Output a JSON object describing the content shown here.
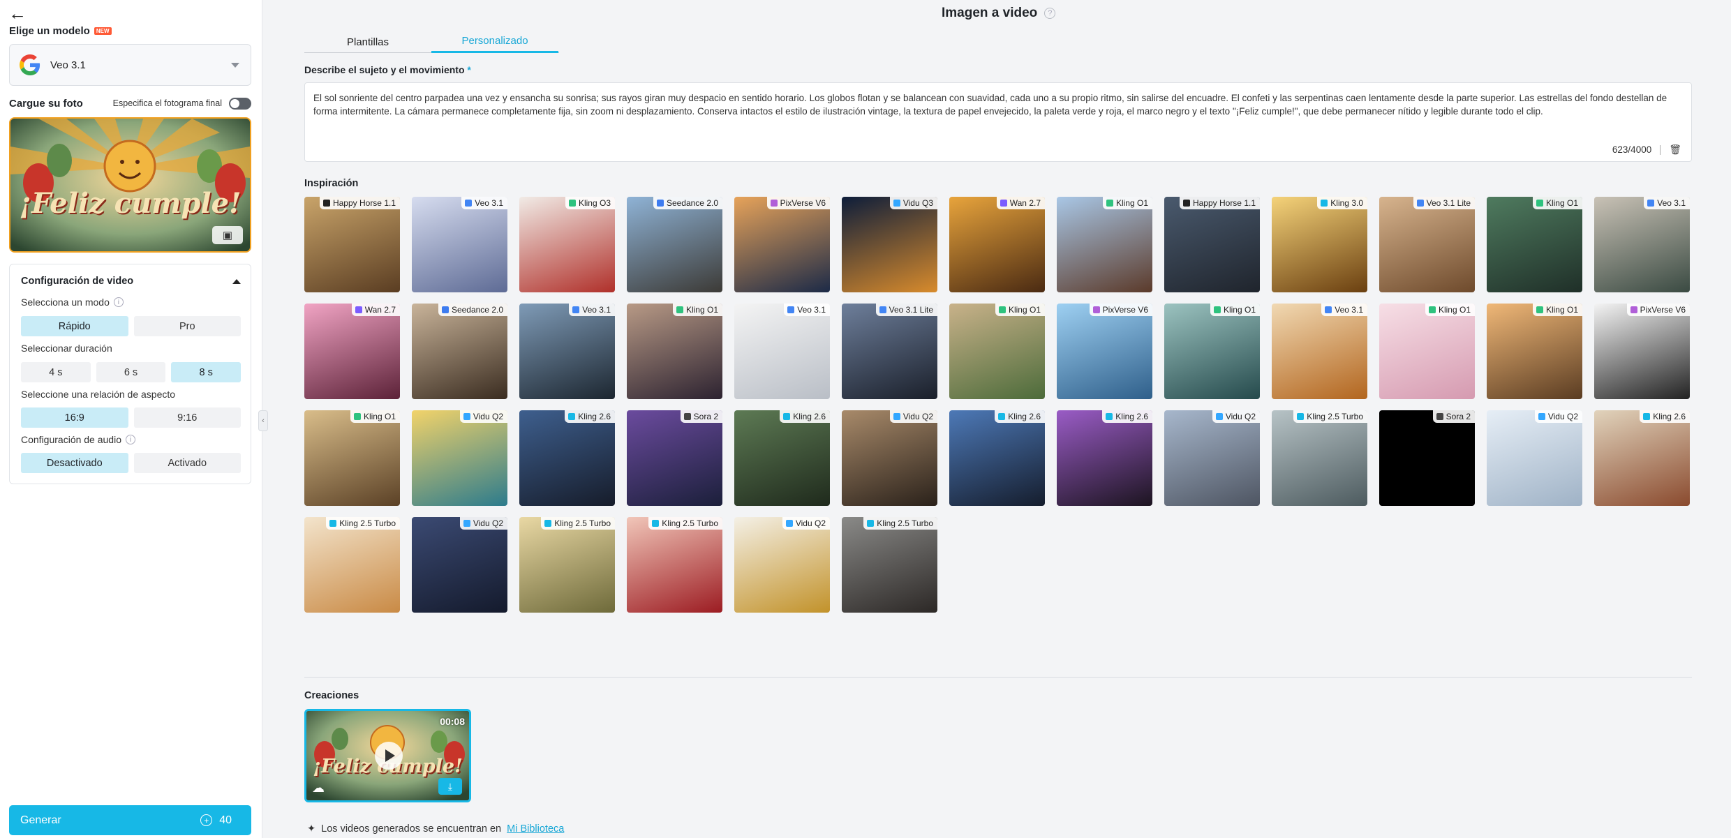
{
  "sidebar": {
    "back_icon": "arrow-left-icon",
    "model_heading": "Elige un modelo",
    "new_badge": "NEW",
    "model_selected": "Veo 3.1",
    "photo_label": "Cargue su foto",
    "end_frame_label": "Especifica el fotograma final",
    "end_frame_enabled": false,
    "upload_image_text": "¡Feliz cumple!",
    "config": {
      "title": "Configuración de video",
      "mode_label": "Selecciona un modo",
      "modes": [
        "Rápido",
        "Pro"
      ],
      "mode_selected": "Rápido",
      "duration_label": "Seleccionar duración",
      "durations": [
        "4 s",
        "6 s",
        "8 s"
      ],
      "duration_selected": "8 s",
      "aspect_label": "Seleccione una relación de aspecto",
      "aspects": [
        "16:9",
        "9:16"
      ],
      "aspect_selected": "16:9",
      "audio_label": "Configuración de audio",
      "audio_options": [
        "Desactivado",
        "Activado"
      ],
      "audio_selected": "Desactivado"
    },
    "generate_label": "Generar",
    "credits": "40"
  },
  "main": {
    "title": "Imagen a video",
    "tabs": [
      {
        "label": "Plantillas",
        "active": false
      },
      {
        "label": "Personalizado",
        "active": true
      }
    ],
    "description_label": "Describe el sujeto y el movimiento",
    "required_mark": "*",
    "prompt": "El sol sonriente del centro parpadea una vez y ensancha su sonrisa; sus rayos giran muy despacio en sentido horario. Los globos flotan y se balancean con suavidad, cada uno a su propio ritmo, sin salirse del encuadre. El confeti y las serpentinas caen lentamente desde la parte superior. Las estrellas del fondo destellan de forma intermitente. La cámara permanece completamente fija, sin zoom ni desplazamiento. Conserva intactos el estilo de ilustración vintage, la textura de papel envejecido, la paleta verde y roja, el marco negro y el texto \"¡Feliz cumple!\", que debe permanecer nítido y legible durante todo el clip.",
    "char_count": "623/4000",
    "inspiration_label": "Inspiración",
    "inspiration": [
      {
        "model": "Happy Horse 1.1",
        "c1": "#c9a46a",
        "c2": "#5a3d22",
        "dot": "#222222"
      },
      {
        "model": "Veo 3.1",
        "c1": "#d6dcef",
        "c2": "#5e6b95",
        "dot": "#4285f4"
      },
      {
        "model": "Kling O3",
        "c1": "#f1ebe6",
        "c2": "#b0302a",
        "dot": "#2ec27e"
      },
      {
        "model": "Seedance 2.0",
        "c1": "#8fb3d6",
        "c2": "#3c3a36",
        "dot": "#3d7cf0"
      },
      {
        "model": "PixVerse V6",
        "c1": "#e7a35a",
        "c2": "#1c2a47",
        "dot": "#b05fd8"
      },
      {
        "model": "Vidu Q3",
        "c1": "#0d1d3a",
        "c2": "#d88b2c",
        "dot": "#33a7ff"
      },
      {
        "model": "Wan 2.7",
        "c1": "#e8a43c",
        "c2": "#4a2a12",
        "dot": "#7b5cff"
      },
      {
        "model": "Kling O1",
        "c1": "#a9c7e6",
        "c2": "#5b3a2a",
        "dot": "#2ec27e"
      },
      {
        "model": "Happy Horse 1.1",
        "c1": "#4a5a6e",
        "c2": "#1f242c",
        "dot": "#222222"
      },
      {
        "model": "Kling 3.0",
        "c1": "#f5d37a",
        "c2": "#6a3f10",
        "dot": "#17b8e6"
      },
      {
        "model": "Veo 3.1 Lite",
        "c1": "#d7b48e",
        "c2": "#6e4a2c",
        "dot": "#4285f4"
      },
      {
        "model": "Kling O1",
        "c1": "#4f7b5f",
        "c2": "#1f2f28",
        "dot": "#2ec27e"
      },
      {
        "model": "Veo 3.1",
        "c1": "#c9c2b6",
        "c2": "#3a4a42",
        "dot": "#4285f4"
      },
      {
        "model": "Wan 2.7",
        "c1": "#f1a4c4",
        "c2": "#5c2238",
        "dot": "#7b5cff"
      },
      {
        "model": "Seedance 2.0",
        "c1": "#c9b49a",
        "c2": "#3a2c20",
        "dot": "#3d7cf0"
      },
      {
        "model": "Veo 3.1",
        "c1": "#7f9bb7",
        "c2": "#1c2630",
        "dot": "#4285f4"
      },
      {
        "model": "Kling O1",
        "c1": "#b89a86",
        "c2": "#2c2230",
        "dot": "#2ec27e"
      },
      {
        "model": "Veo 3.1",
        "c1": "#f4f4f4",
        "c2": "#b9bec6",
        "dot": "#4285f4"
      },
      {
        "model": "Veo 3.1 Lite",
        "c1": "#6e7f9b",
        "c2": "#1a1f2a",
        "dot": "#4285f4"
      },
      {
        "model": "Kling O1",
        "c1": "#c9b28a",
        "c2": "#4c6b3a",
        "dot": "#2ec27e"
      },
      {
        "model": "PixVerse V6",
        "c1": "#9ed0f2",
        "c2": "#2f5f8a",
        "dot": "#b05fd8"
      },
      {
        "model": "Kling O1",
        "c1": "#9cc3c0",
        "c2": "#254a4c",
        "dot": "#2ec27e"
      },
      {
        "model": "Veo 3.1",
        "c1": "#f1d9b3",
        "c2": "#b2651e",
        "dot": "#4285f4"
      },
      {
        "model": "Kling O1",
        "c1": "#f7dfe6",
        "c2": "#d59ab0",
        "dot": "#2ec27e"
      },
      {
        "model": "Kling O1",
        "c1": "#f0b878",
        "c2": "#5a3c22",
        "dot": "#2ec27e"
      },
      {
        "model": "PixVerse V6",
        "c1": "#f4f4f4",
        "c2": "#222222",
        "dot": "#b05fd8"
      },
      {
        "model": "Kling O1",
        "c1": "#d9bd8a",
        "c2": "#5b4126",
        "dot": "#2ec27e"
      },
      {
        "model": "Vidu Q2",
        "c1": "#f2d36a",
        "c2": "#2c7b8c",
        "dot": "#33a7ff"
      },
      {
        "model": "Kling 2.6",
        "c1": "#3e5f8e",
        "c2": "#161c2a",
        "dot": "#17b8e6"
      },
      {
        "model": "Sora 2",
        "c1": "#6b4b9e",
        "c2": "#1b1f3a",
        "dot": "#444444"
      },
      {
        "model": "Kling 2.6",
        "c1": "#5d7a54",
        "c2": "#1f2a1c",
        "dot": "#17b8e6"
      },
      {
        "model": "Vidu Q2",
        "c1": "#a88a6a",
        "c2": "#2a211a",
        "dot": "#33a7ff"
      },
      {
        "model": "Kling 2.6",
        "c1": "#4d79b7",
        "c2": "#151d2d",
        "dot": "#17b8e6"
      },
      {
        "model": "Kling 2.6",
        "c1": "#9a5cc6",
        "c2": "#1c1420",
        "dot": "#17b8e6"
      },
      {
        "model": "Vidu Q2",
        "c1": "#a7b7cc",
        "c2": "#4e5562",
        "dot": "#33a7ff"
      },
      {
        "model": "Kling 2.5 Turbo",
        "c1": "#b7c3c6",
        "c2": "#4d5b5f",
        "dot": "#17b8e6"
      },
      {
        "model": "Sora 2",
        "c1": "#000000",
        "c2": "#000000",
        "dot": "#444444"
      },
      {
        "model": "Vidu Q2",
        "c1": "#e6eef6",
        "c2": "#9fb2c6",
        "dot": "#33a7ff"
      },
      {
        "model": "Kling 2.6",
        "c1": "#e1d3bc",
        "c2": "#8a4a2e",
        "dot": "#17b8e6"
      },
      {
        "model": "Kling 2.5 Turbo",
        "c1": "#f3e4cc",
        "c2": "#c98a45",
        "dot": "#17b8e6"
      },
      {
        "model": "Vidu Q2",
        "c1": "#3b4a73",
        "c2": "#141a2c",
        "dot": "#33a7ff"
      },
      {
        "model": "Kling 2.5 Turbo",
        "c1": "#e9d8a4",
        "c2": "#6e6a3a",
        "dot": "#17b8e6"
      },
      {
        "model": "Kling 2.5 Turbo",
        "c1": "#f1c6b9",
        "c2": "#9c1c22",
        "dot": "#17b8e6"
      },
      {
        "model": "Vidu Q2",
        "c1": "#f4f0e6",
        "c2": "#c2922a",
        "dot": "#33a7ff"
      },
      {
        "model": "Kling 2.5 Turbo",
        "c1": "#8a8a88",
        "c2": "#2c2826",
        "dot": "#17b8e6"
      }
    ],
    "creations_label": "Creaciones",
    "creation": {
      "duration": "00:08",
      "image_text": "¡Feliz cumple!"
    },
    "library_note": "Los videos generados se encuentran en",
    "library_link": "Mi Biblioteca"
  }
}
